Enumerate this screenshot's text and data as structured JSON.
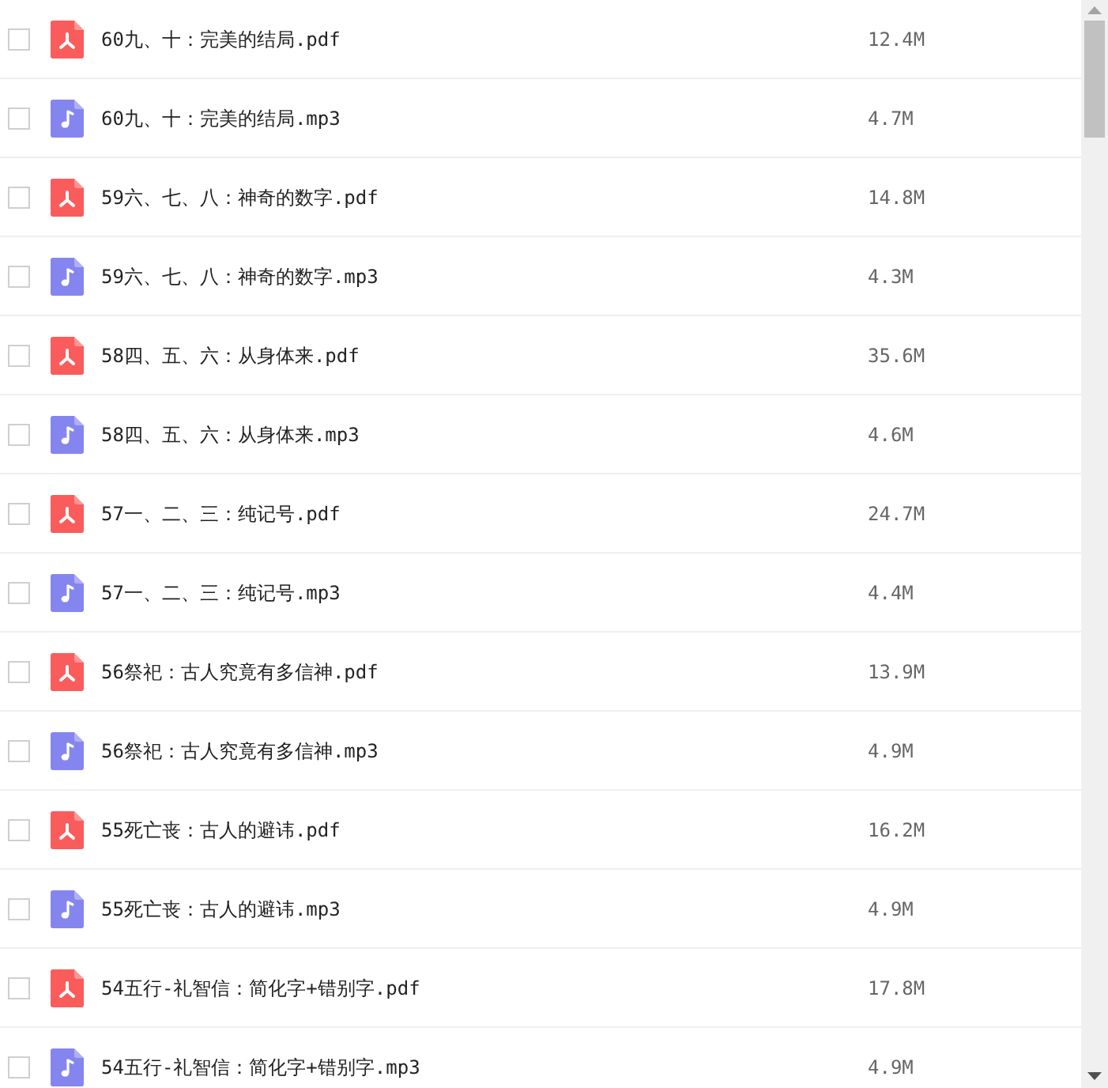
{
  "files": [
    {
      "kind": "pdf",
      "name": "60九、十：完美的结局.pdf",
      "size": "12.4M",
      "checked": false
    },
    {
      "kind": "mp3",
      "name": "60九、十：完美的结局.mp3",
      "size": "4.7M",
      "checked": false
    },
    {
      "kind": "pdf",
      "name": "59六、七、八：神奇的数字.pdf",
      "size": "14.8M",
      "checked": false
    },
    {
      "kind": "mp3",
      "name": "59六、七、八：神奇的数字.mp3",
      "size": "4.3M",
      "checked": false
    },
    {
      "kind": "pdf",
      "name": "58四、五、六：从身体来.pdf",
      "size": "35.6M",
      "checked": false
    },
    {
      "kind": "mp3",
      "name": "58四、五、六：从身体来.mp3",
      "size": "4.6M",
      "checked": false
    },
    {
      "kind": "pdf",
      "name": "57一、二、三：纯记号.pdf",
      "size": "24.7M",
      "checked": false
    },
    {
      "kind": "mp3",
      "name": "57一、二、三：纯记号.mp3",
      "size": "4.4M",
      "checked": false
    },
    {
      "kind": "pdf",
      "name": "56祭祀：古人究竟有多信神.pdf",
      "size": "13.9M",
      "checked": false
    },
    {
      "kind": "mp3",
      "name": "56祭祀：古人究竟有多信神.mp3",
      "size": "4.9M",
      "checked": false
    },
    {
      "kind": "pdf",
      "name": "55死亡丧：古人的避讳.pdf",
      "size": "16.2M",
      "checked": false
    },
    {
      "kind": "mp3",
      "name": "55死亡丧：古人的避讳.mp3",
      "size": "4.9M",
      "checked": false
    },
    {
      "kind": "pdf",
      "name": "54五行-礼智信：简化字+错别字.pdf",
      "size": "17.8M",
      "checked": false
    },
    {
      "kind": "mp3",
      "name": "54五行-礼智信：简化字+错别字.mp3",
      "size": "4.9M",
      "checked": false
    }
  ]
}
